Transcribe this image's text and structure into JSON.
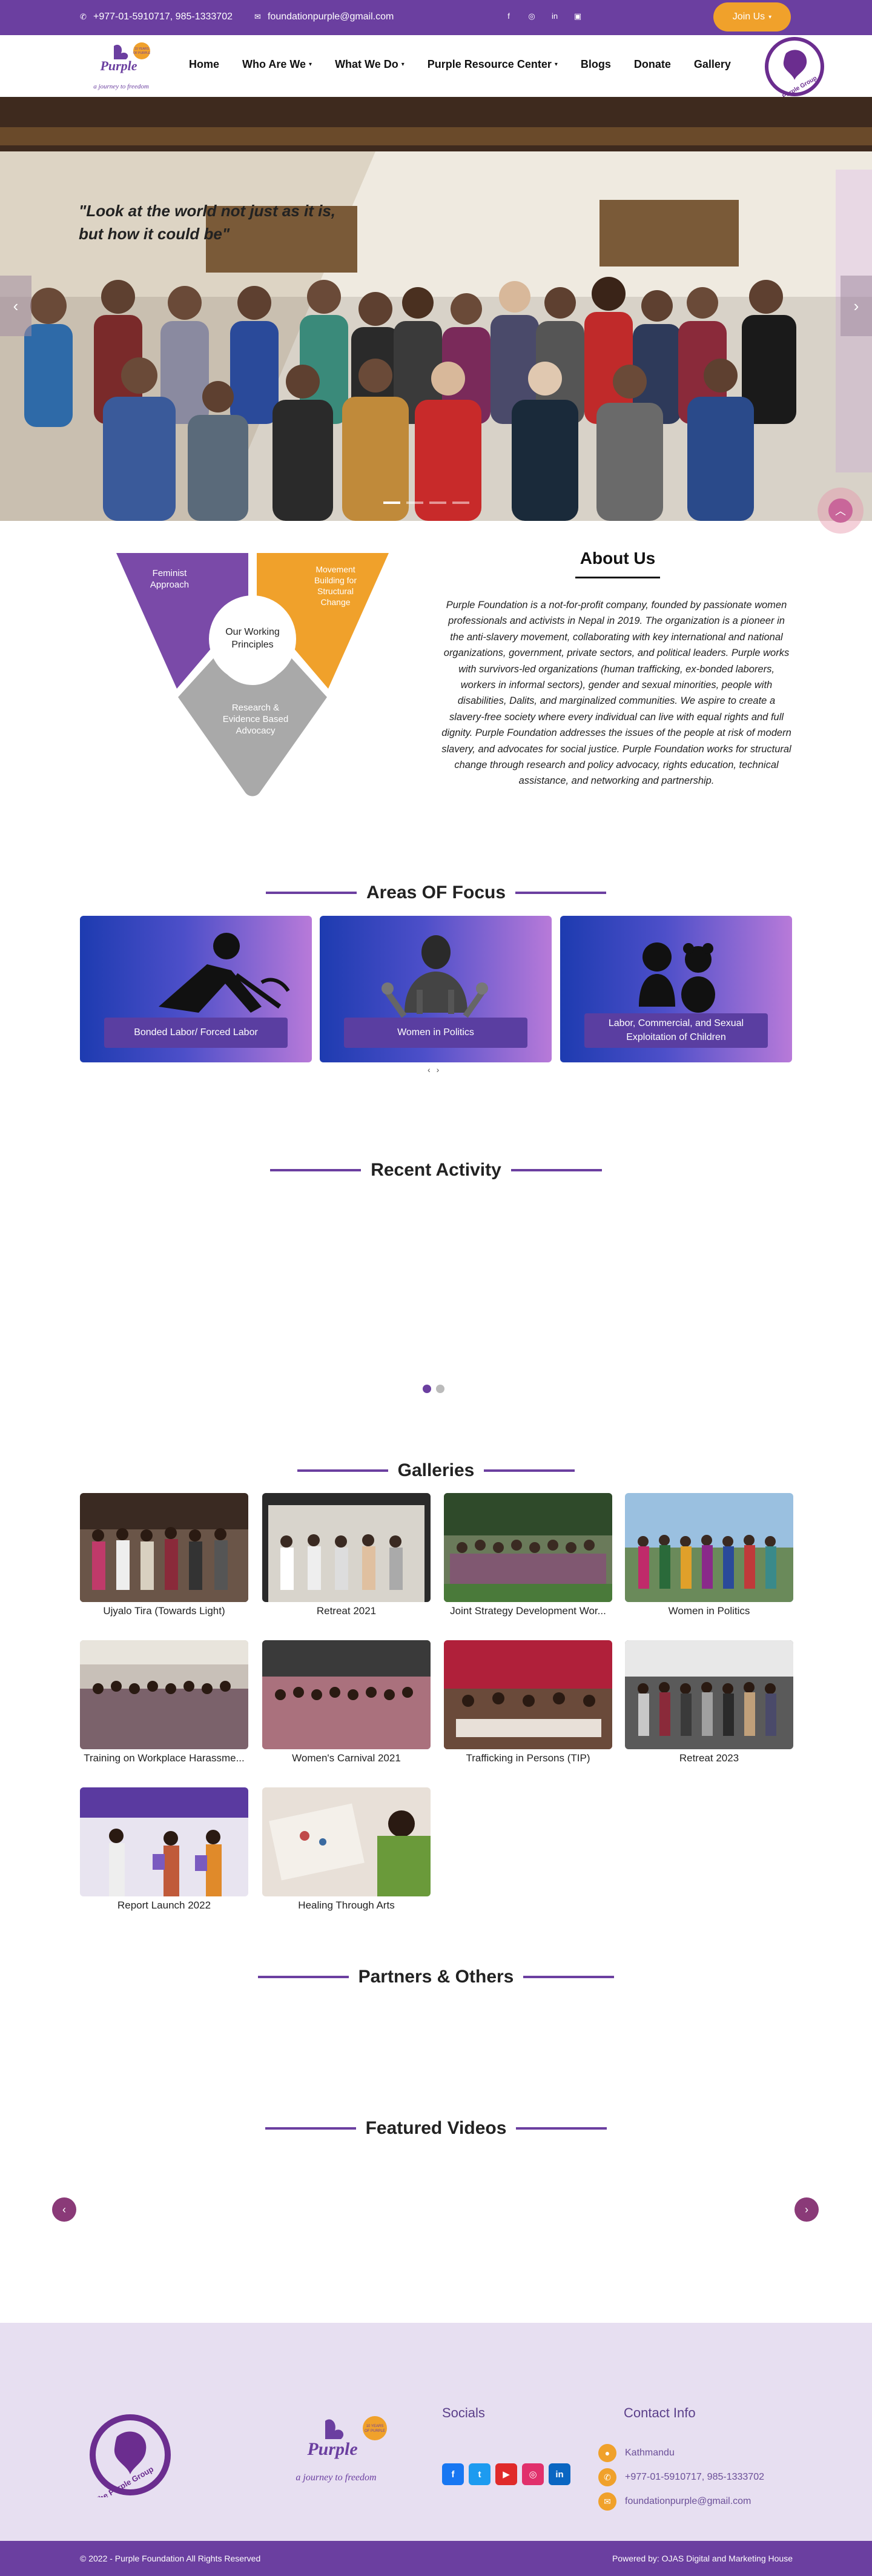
{
  "topbar": {
    "phone": "+977-01-5910717, 985-1333702",
    "email": "foundationpurple@gmail.com",
    "socials": [
      "facebook-icon",
      "instagram-icon",
      "linkedin-icon",
      "youtube-icon"
    ],
    "join_label": "Join Us"
  },
  "nav": {
    "items": [
      "Home",
      "Who Are We",
      "What We Do",
      "Purple Resource Center",
      "Blogs",
      "Donate",
      "Gallery"
    ]
  },
  "logo": {
    "name": "Purple",
    "tagline": "a journey to freedom",
    "badge": "10 YEARS OF PURPLE",
    "group_name": "The Purple Group"
  },
  "hero": {
    "quote_line1": "\"Look at the world not just as it is,",
    "quote_line2": "but how it could be\"",
    "prev": "‹",
    "next": "›",
    "slides": 4,
    "active_slide": 1
  },
  "principles": {
    "center": "Our Working Principles",
    "left": "Feminist Approach",
    "right": "Movement Building for Structural Change",
    "bottom": "Research & Evidence Based Advocacy"
  },
  "about": {
    "title": "About Us",
    "text": "Purple Foundation is a not-for-profit company, founded by passionate women professionals and activists in Nepal in 2019. The organization is a pioneer in the anti-slavery movement, collaborating with key international and national organizations, government, private sectors, and political leaders. Purple works with survivors-led organizations (human trafficking, ex-bonded laborers, workers in informal sectors), gender and sexual minorities, people with disabilities, Dalits, and marginalized communities. We aspire to create a slavery-free society where every individual can live with equal rights and full dignity. Purple Foundation addresses the issues of the people at risk of modern slavery, and advocates for social justice. Purple Foundation works for structural change through research and policy advocacy, rights education, technical assistance, and networking and partnership."
  },
  "focus": {
    "title": "Areas OF Focus",
    "cards": [
      {
        "label": "Bonded Labor/ Forced Labor"
      },
      {
        "label": "Women in Politics"
      },
      {
        "label": "Labor, Commercial, and Sexual Exploitation of Children"
      }
    ],
    "prev": "‹",
    "next": "›"
  },
  "activity": {
    "title": "Recent Activity",
    "pages": 2,
    "active_page": 1
  },
  "galleries": {
    "title": "Galleries",
    "items": [
      {
        "caption": "Ujyalo Tira (Towards Light)"
      },
      {
        "caption": "Retreat 2021"
      },
      {
        "caption": "Joint Strategy Development Wor..."
      },
      {
        "caption": "Women in Politics"
      },
      {
        "caption": "Training on Workplace Harassme..."
      },
      {
        "caption": "Women's Carnival 2021"
      },
      {
        "caption": "Trafficking in Persons (TIP)"
      },
      {
        "caption": "Retreat 2023"
      },
      {
        "caption": "Report Launch 2022"
      },
      {
        "caption": "Healing Through Arts"
      }
    ]
  },
  "partners": {
    "title": "Partners & Others"
  },
  "videos": {
    "title": "Featured Videos",
    "prev": "‹",
    "next": "›"
  },
  "footer": {
    "socials_title": "Socials",
    "social_icons": [
      "facebook-icon",
      "twitter-icon",
      "youtube-icon",
      "instagram-icon",
      "linkedin-icon"
    ],
    "contact_title": "Contact Info",
    "location": "Kathmandu",
    "phone": "+977-01-5910717, 985-1333702",
    "email": "foundationpurple@gmail.com",
    "copyright": "© 2022 - Purple Foundation All Rights Reserved",
    "powered": "Powered by: OJAS Digital and Marketing House"
  },
  "colors": {
    "brand_purple": "#6b3fa0",
    "accent_orange": "#f0a12b",
    "footer_bg": "#e7dff1"
  }
}
